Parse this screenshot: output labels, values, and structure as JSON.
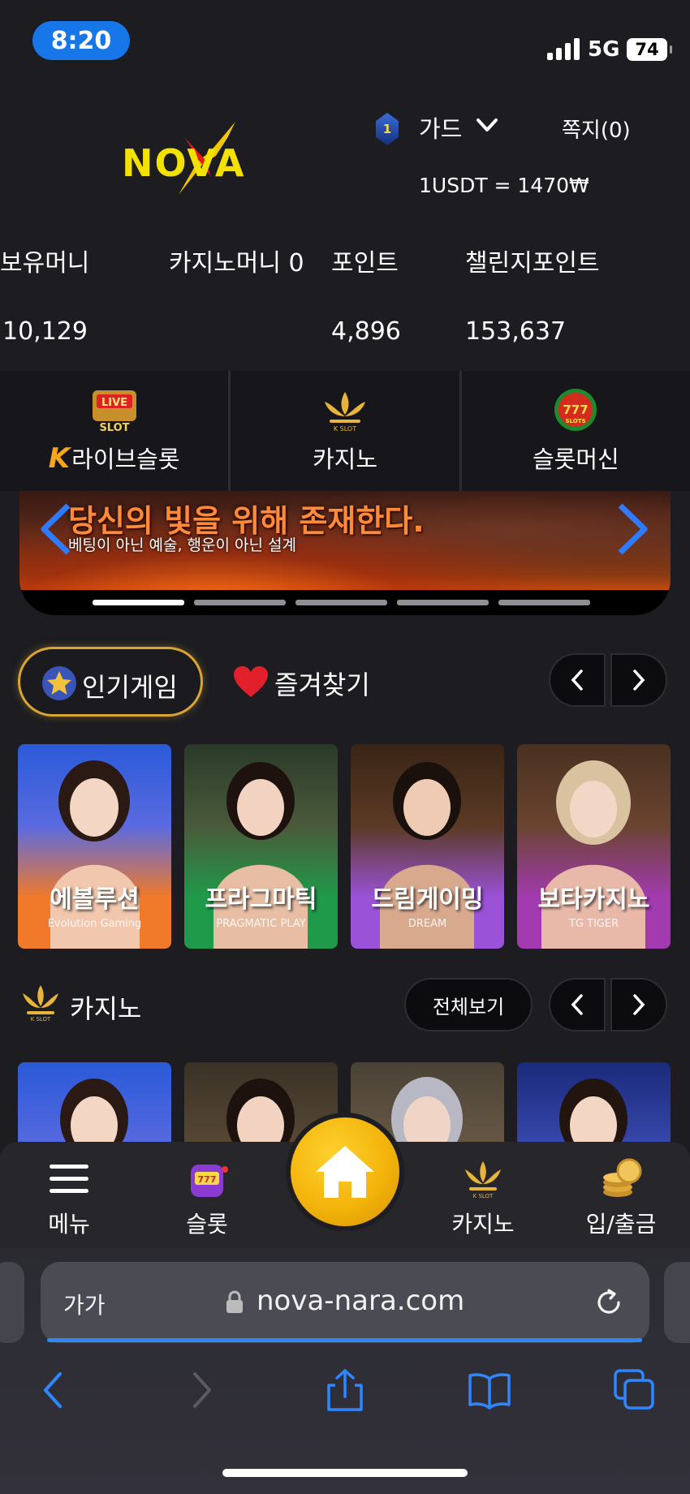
{
  "status_bar": {
    "time": "8:20",
    "network": "5G",
    "battery": "74"
  },
  "header": {
    "logo_text": "NOVA",
    "rank_level": "1",
    "rank_name": "가드",
    "messages_label": "쪽지(0)",
    "exchange_rate": "1USDT = 1470₩"
  },
  "balances": {
    "held_money_label": "보유머니",
    "held_money_value": "10,129",
    "casino_money_label": "카지노머니 0",
    "points_label": "포인트",
    "points_value": "4,896",
    "challenge_points_label": "챌린지포인트",
    "challenge_points_value": "153,637"
  },
  "categories": [
    {
      "label": "라이브슬롯",
      "prefix": "K",
      "icon": "live-slot-icon"
    },
    {
      "label": "카지노",
      "icon": "k-slot-lotus-icon"
    },
    {
      "label": "슬롯머신",
      "icon": "777-slots-icon"
    }
  ],
  "banner": {
    "headline": "당신의 빛을 위해 존재한다.",
    "subtext": "베팅이 아닌 예술, 행운이 아닌 설계",
    "active_slide": 1,
    "slide_count": 5
  },
  "tabs": {
    "popular_label": "인기게임",
    "favorites_label": "즐겨찾기"
  },
  "popular_games": [
    {
      "title": "에볼루션",
      "brand": "Evolution Gaming",
      "color_top": "#2a5ad8",
      "color_bottom": "#f07a2a"
    },
    {
      "title": "프라그마틱",
      "brand": "PRAGMATIC PLAY",
      "color_top": "#2a3a2a",
      "color_bottom": "#1f9a4a"
    },
    {
      "title": "드림게이밍",
      "brand": "DREAM",
      "color_top": "#3a2416",
      "color_bottom": "#9a52d8"
    },
    {
      "title": "보타카지노",
      "brand": "TG TIGER",
      "color_top": "#4a3020",
      "color_bottom": "#a33ab0"
    }
  ],
  "casino_section": {
    "title": "카지노",
    "view_all_label": "전체보기"
  },
  "app_nav": {
    "menu_label": "메뉴",
    "slot_label": "슬롯",
    "casino_label": "카지노",
    "deposit_label": "입/출금"
  },
  "browser": {
    "aa_label": "가가",
    "url": "nova-nara.com"
  },
  "colors": {
    "background": "#1c1c21",
    "accent_gold": "#f3b40b",
    "time_pill": "#1877e8",
    "url_progress": "#2f87ff"
  }
}
